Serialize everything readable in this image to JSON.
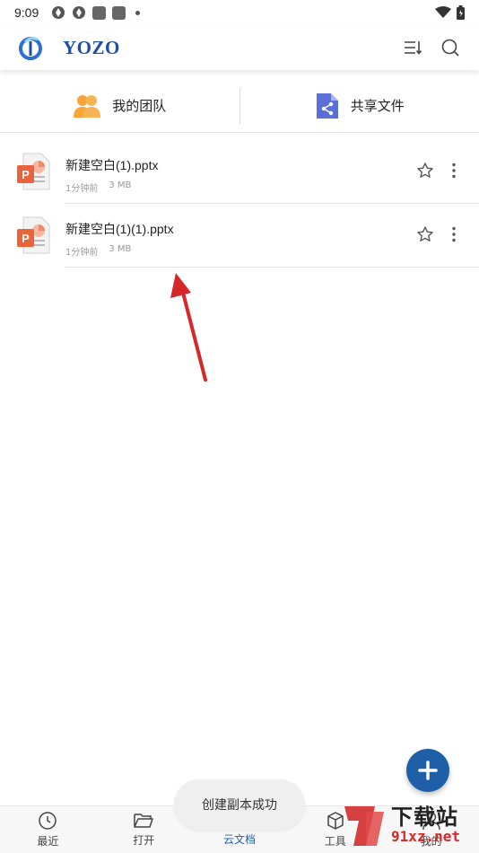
{
  "status_bar": {
    "time": "9:09"
  },
  "header": {
    "brand": "YOZO"
  },
  "quick_entries": [
    {
      "label": "我的团队",
      "icon": "team-icon"
    },
    {
      "label": "共享文件",
      "icon": "share-file-icon"
    }
  ],
  "files": [
    {
      "name": "新建空白(1).pptx",
      "time": "1分钟前",
      "size": "3 MB",
      "icon": "pptx-file-icon"
    },
    {
      "name": "新建空白(1)(1).pptx",
      "time": "1分钟前",
      "size": "3 MB",
      "icon": "pptx-file-icon"
    }
  ],
  "bottom_nav": [
    {
      "label": "最近",
      "icon": "clock-icon",
      "active": false
    },
    {
      "label": "打开",
      "icon": "folder-open-icon",
      "active": false
    },
    {
      "label": "云文档",
      "icon": "cloud-icon",
      "active": true
    },
    {
      "label": "工具",
      "icon": "box-icon",
      "active": false
    },
    {
      "label": "我的",
      "icon": "person-icon",
      "active": false
    }
  ],
  "toast": {
    "message": "创建副本成功"
  },
  "watermark": {
    "title": "下载站",
    "site": "91xz.net"
  },
  "colors": {
    "brand_blue": "#1f5fa8",
    "annotation_red": "#d62828",
    "pptx_orange": "#e8643c"
  }
}
